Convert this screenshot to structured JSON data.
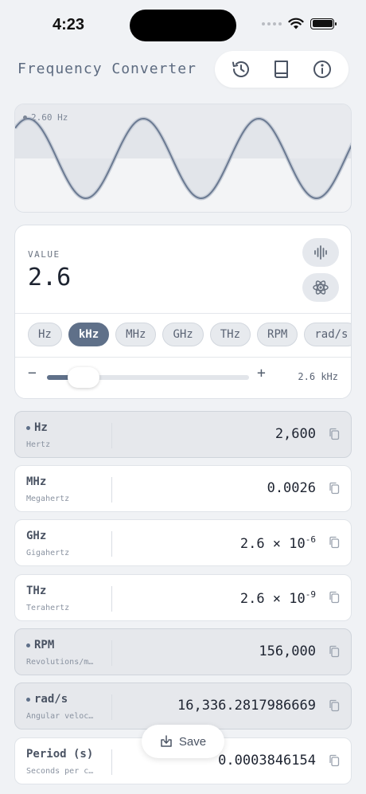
{
  "status": {
    "time": "4:23"
  },
  "app": {
    "title": "Frequency Converter"
  },
  "toolbar": {
    "icons": [
      "history-icon",
      "book-icon",
      "info-icon"
    ]
  },
  "waveform": {
    "label": "2.60 Hz"
  },
  "input": {
    "label": "VALUE",
    "value": "2.6",
    "units": [
      "Hz",
      "kHz",
      "MHz",
      "GHz",
      "THz",
      "RPM",
      "rad/s"
    ],
    "selected_unit": "kHz",
    "slider_minus": "−",
    "slider_plus": "+",
    "slider_readout": "2.6 kHz",
    "slider_fraction": 0.18
  },
  "results": [
    {
      "unit": "Hz",
      "desc": "Hertz",
      "value": "2,600",
      "highlight": true,
      "marked": true
    },
    {
      "unit": "MHz",
      "desc": "Megahertz",
      "value": "0.0026",
      "highlight": false,
      "marked": false
    },
    {
      "unit": "GHz",
      "desc": "Gigahertz",
      "value_base": "2.6 × 10",
      "value_exp": "-6",
      "highlight": false,
      "marked": false
    },
    {
      "unit": "THz",
      "desc": "Terahertz",
      "value_base": "2.6 × 10",
      "value_exp": "-9",
      "highlight": false,
      "marked": false
    },
    {
      "unit": "RPM",
      "desc": "Revolutions/m…",
      "value": "156,000",
      "highlight": true,
      "marked": true
    },
    {
      "unit": "rad/s",
      "desc": "Angular veloc…",
      "value": "16,336.2817986669",
      "highlight": true,
      "marked": true
    },
    {
      "unit": "Period (s)",
      "desc": "Seconds per c…",
      "value": "0.0003846154",
      "highlight": false,
      "marked": false
    }
  ],
  "save": {
    "label": "Save"
  },
  "colors": {
    "accent": "#5f7089",
    "background": "#f0f2f5",
    "wave": "#6b7a92"
  }
}
